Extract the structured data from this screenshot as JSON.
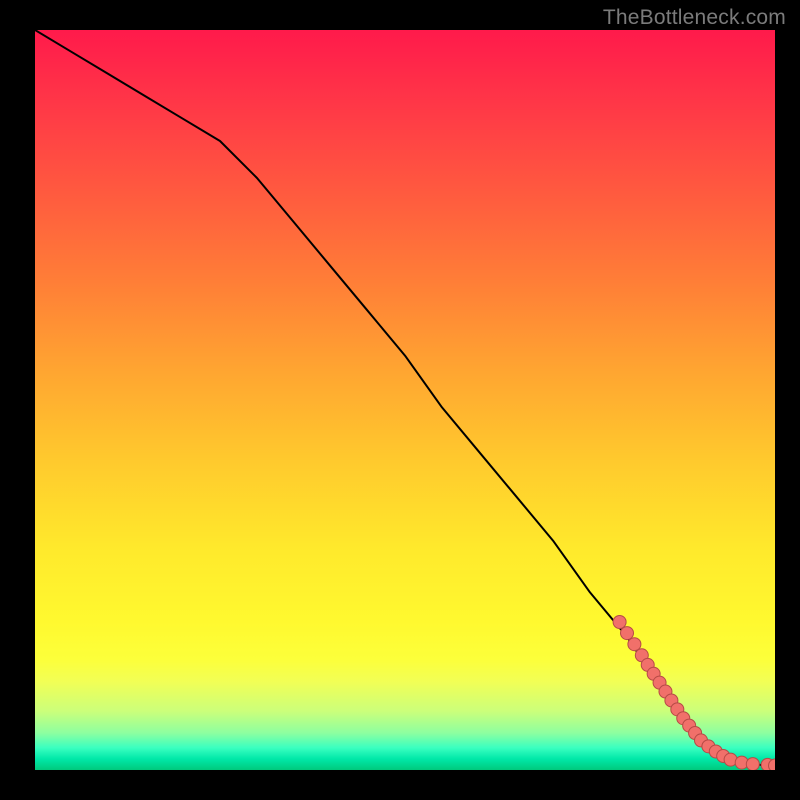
{
  "watermark": "TheBottleneck.com",
  "colors": {
    "curve": "#000000",
    "dot_fill": "#f1706a",
    "dot_stroke": "#b64a46",
    "gradient_top": "#ff1a4b",
    "gradient_bottom": "#00c97c"
  },
  "chart_data": {
    "type": "line",
    "title": "",
    "xlabel": "",
    "ylabel": "",
    "xlim": [
      0,
      100
    ],
    "ylim": [
      0,
      100
    ],
    "grid": false,
    "legend": false,
    "series": [
      {
        "name": "curve",
        "kind": "line",
        "x": [
          0,
          5,
          10,
          15,
          20,
          25,
          30,
          35,
          40,
          45,
          50,
          55,
          60,
          65,
          70,
          75,
          80,
          82,
          84,
          86,
          88,
          90,
          92,
          94,
          96,
          98,
          100
        ],
        "y": [
          100,
          97,
          94,
          91,
          88,
          85,
          80,
          74,
          68,
          62,
          56,
          49,
          43,
          37,
          31,
          24,
          18,
          15,
          12,
          9,
          6,
          4,
          2.5,
          1.5,
          1,
          0.7,
          0.6
        ]
      },
      {
        "name": "dots",
        "kind": "scatter",
        "x": [
          79.0,
          80.0,
          81.0,
          82.0,
          82.8,
          83.6,
          84.4,
          85.2,
          86.0,
          86.8,
          87.6,
          88.4,
          89.2,
          90.0,
          91.0,
          92.0,
          93.0,
          94.0,
          95.5,
          97.0,
          99.0,
          100.0
        ],
        "y": [
          20.0,
          18.5,
          17.0,
          15.5,
          14.2,
          13.0,
          11.8,
          10.6,
          9.4,
          8.2,
          7.0,
          6.0,
          5.0,
          4.0,
          3.2,
          2.5,
          1.9,
          1.4,
          1.0,
          0.8,
          0.7,
          0.6
        ]
      }
    ]
  }
}
